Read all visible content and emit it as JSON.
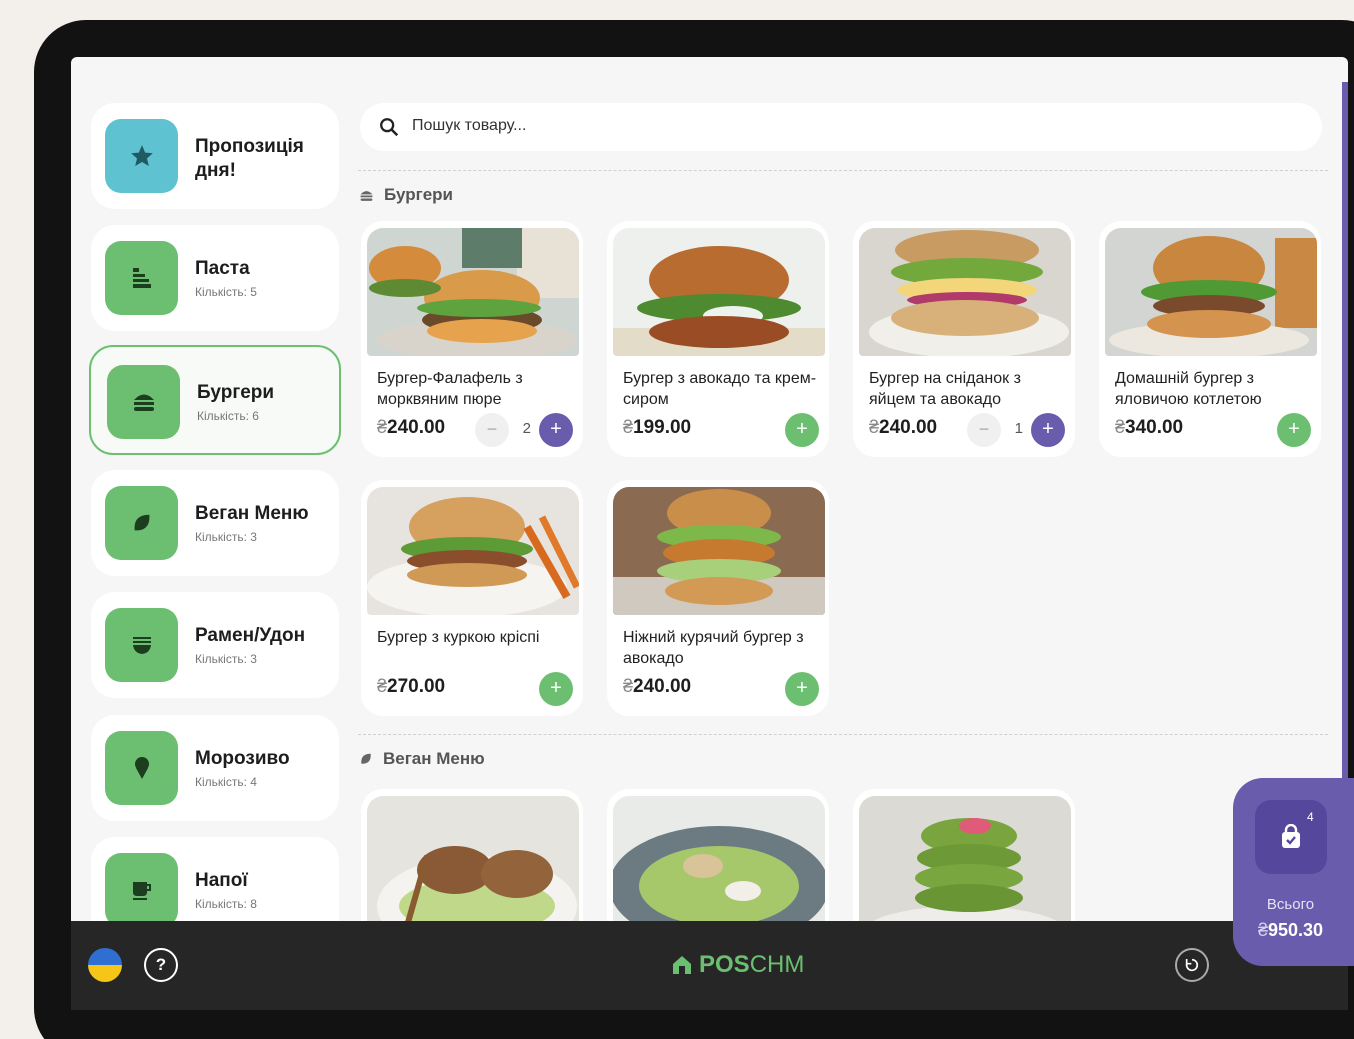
{
  "search": {
    "placeholder": "Пошук товару..."
  },
  "categories": [
    {
      "name": "Пропозиція дня!",
      "count": "",
      "icon": "star-icon",
      "active": false
    },
    {
      "name": "Паста",
      "count": "Кількість: 5",
      "icon": "pasta-icon",
      "active": false
    },
    {
      "name": "Бургери",
      "count": "Кількість: 6",
      "icon": "burger-icon",
      "active": true
    },
    {
      "name": "Веган Меню",
      "count": "Кількість: 3",
      "icon": "leaf-icon",
      "active": false
    },
    {
      "name": "Рамен/Удон",
      "count": "Кількість: 3",
      "icon": "noodle-bowl-icon",
      "active": false
    },
    {
      "name": "Морозиво",
      "count": "Кількість: 4",
      "icon": "ice-cream-icon",
      "active": false
    },
    {
      "name": "Напої",
      "count": "Кількість: 8",
      "icon": "cup-icon",
      "active": false
    }
  ],
  "sections": [
    {
      "title": "Бургери",
      "icon": "burger-icon"
    },
    {
      "title": "Веган Меню",
      "icon": "leaf-icon"
    }
  ],
  "products": [
    {
      "title": "Бургер-Фалафель з морквяним пюре",
      "currency": "₴",
      "price": "240.00",
      "qty": "2"
    },
    {
      "title": "Бургер з авокадо та крем-сиром",
      "currency": "₴",
      "price": "199.00",
      "qty": ""
    },
    {
      "title": "Бургер на сніданок з яйцем та авокадо",
      "currency": "₴",
      "price": "240.00",
      "qty": "1"
    },
    {
      "title": "Домашній бургер з яловичою котлетою",
      "currency": "₴",
      "price": "340.00",
      "qty": ""
    },
    {
      "title": "Бургер з куркою кріспі",
      "currency": "₴",
      "price": "270.00",
      "qty": ""
    },
    {
      "title": "Ніжний курячий бургер з авокадо",
      "currency": "₴",
      "price": "240.00",
      "qty": ""
    }
  ],
  "bottom": {
    "help": "?",
    "logo_bold": "POS",
    "logo_rest": "CHM"
  },
  "cart": {
    "badge": "4",
    "total_label": "Всього",
    "currency": "₴",
    "total": "950.30"
  },
  "colors": {
    "accent_green": "#6cbf70",
    "accent_purple": "#6a5cad",
    "tile_blue": "#5fc2d0"
  }
}
